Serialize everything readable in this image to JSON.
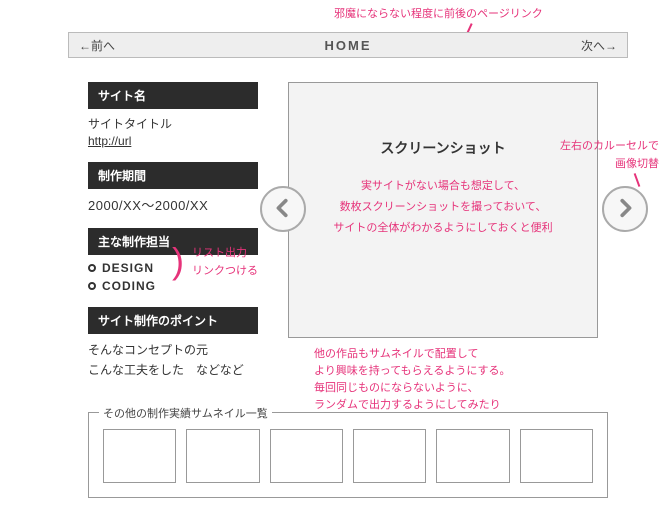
{
  "notes": {
    "topnav": "邪魔にならない程度に前後のページリンク",
    "carousel": "左右のカルーセルで\n画像切替",
    "roles_line1": "リスト出力",
    "roles_line2": "リンクつける",
    "thumbs": "他の作品もサムネイルで配置して\nより興味を持ってもらえるようにする。\n毎回同じものにならないように、\nランダムで出力するようにしてみたり"
  },
  "topnav": {
    "prev": "←前へ",
    "home": "HOME",
    "next": "次へ→"
  },
  "left": {
    "sitename": {
      "heading": "サイト名",
      "title": "サイトタイトル",
      "url": "http://url"
    },
    "period": {
      "heading": "制作期間",
      "value": "2000/XX〜2000/XX"
    },
    "roles": {
      "heading": "主な制作担当",
      "items": [
        "DESIGN",
        "CODING"
      ]
    },
    "points": {
      "heading": "サイト制作のポイント",
      "text": "そんなコンセプトの元\nこんな工夫をした　などなど"
    }
  },
  "carousel": {
    "title": "スクリーンショット",
    "desc": "実サイトがない場合も想定して、\n数枚スクリーンショットを撮っておいて、\nサイトの全体がわかるようにしておくと便利"
  },
  "thumbs": {
    "title": "その他の制作実績サムネイル一覧"
  }
}
